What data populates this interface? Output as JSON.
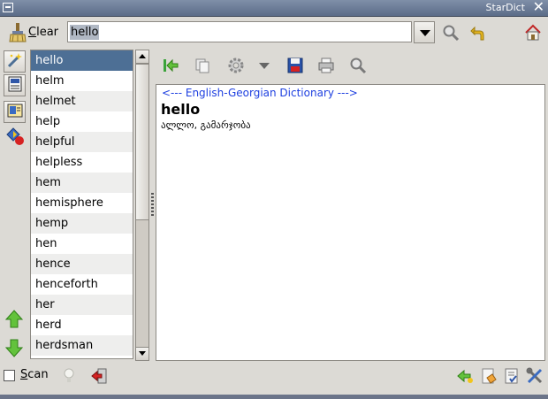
{
  "window": {
    "title": "StarDict"
  },
  "header": {
    "clear_label": "Clear",
    "clear_underline": "C",
    "clear_rest": "lear",
    "search_value": "hello",
    "icons": [
      "clear-broom-icon",
      "dropdown-icon",
      "search-icon",
      "back-icon",
      "home-icon"
    ]
  },
  "sidebar": {
    "icons": [
      "fuzzy-search-icon",
      "dict-list-icon",
      "dict-info-icon",
      "dict-manage-icon",
      "up-arrow-icon",
      "down-arrow-icon"
    ]
  },
  "wordlist": {
    "selected_index": 0,
    "items": [
      "hello",
      "helm",
      "helmet",
      "help",
      "helpful",
      "helpless",
      "hem",
      "hemisphere",
      "hemp",
      "hen",
      "hence",
      "henceforth",
      "her",
      "herd",
      "herdsman"
    ]
  },
  "toolbar": {
    "icons": [
      "go-back-icon",
      "copy-icon",
      "pronounce-icon",
      "menu-dropdown-icon",
      "save-icon",
      "print-icon",
      "search-in-text-icon"
    ]
  },
  "definition": {
    "dictionary": "<--- English-Georgian Dictionary --->",
    "word": "hello",
    "translation": "ალლო, გამარჯობა"
  },
  "bottom": {
    "scan_label": "Scan",
    "scan_underline": "S",
    "scan_rest": "can",
    "scan_checked": false,
    "icons": [
      "bulb-icon",
      "quit-icon",
      "new-version-icon",
      "manual-icon",
      "dict-manager-icon",
      "preferences-icon"
    ]
  },
  "colors": {
    "selection": "#4d6f95",
    "dict_name": "#1d3fe0",
    "title_bar": "#6b7b96"
  }
}
